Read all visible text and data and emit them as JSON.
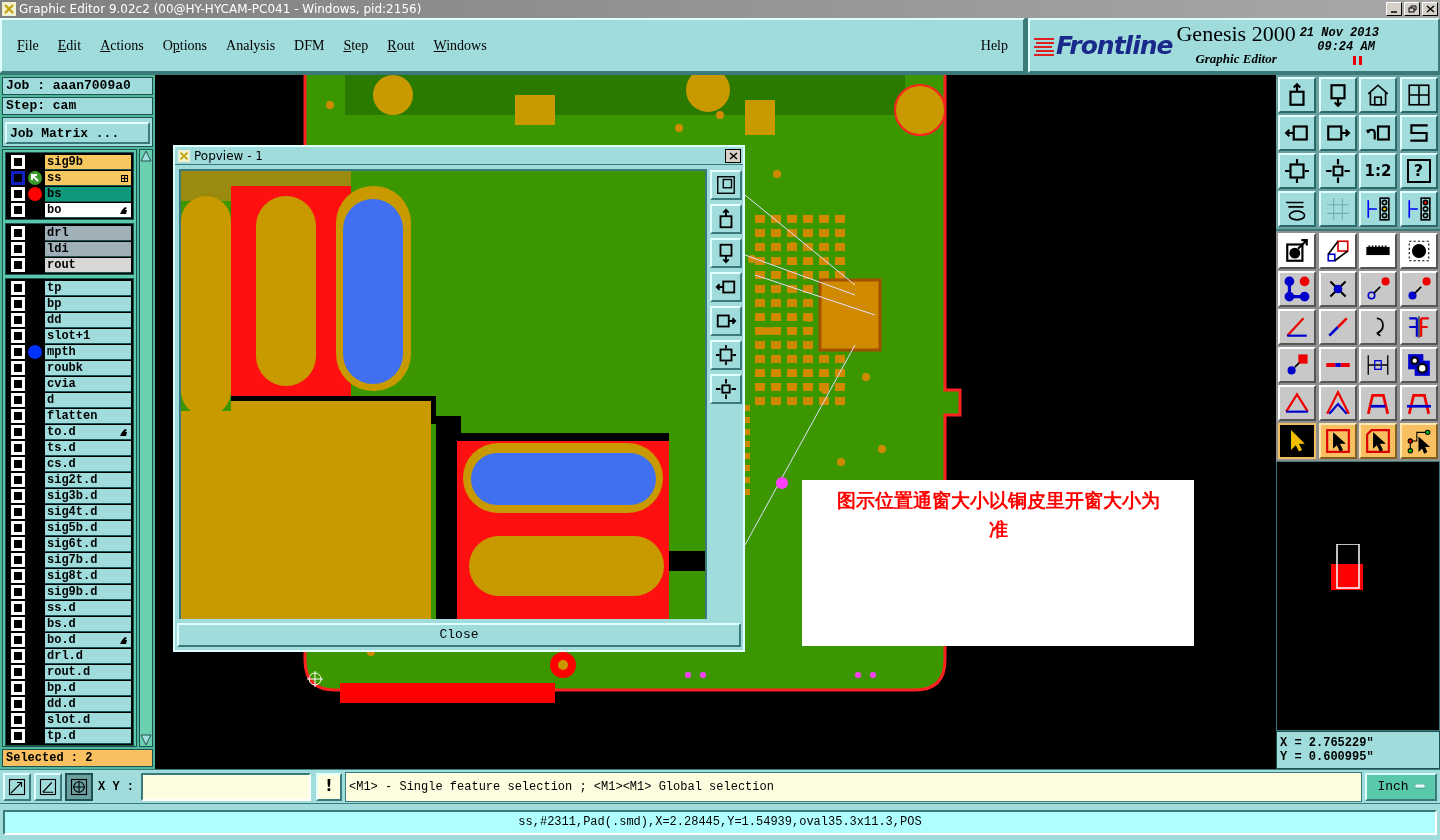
{
  "window": {
    "title": "Graphic Editor 9.02c2 (00@HY-HYCAM-PC041 - Windows, pid:2156)"
  },
  "menu": [
    {
      "key": "F",
      "rest": "ile"
    },
    {
      "key": "E",
      "rest": "dit"
    },
    {
      "key": "A",
      "rest": "ctions"
    },
    {
      "lead": "O",
      "key": "p",
      "rest": "tions"
    },
    {
      "lead": "Analysis"
    },
    {
      "lead": "DFM"
    },
    {
      "key": "S",
      "rest": "tep"
    },
    {
      "key": "R",
      "rest": "out"
    },
    {
      "key": "W",
      "rest": "indows"
    }
  ],
  "help": "Help",
  "brand": {
    "logo": "Frontline",
    "product": "Genesis 2000",
    "subtitle": "Graphic Editor",
    "date": "21 Nov 2013",
    "time": "09:24 AM"
  },
  "job": "Job : aaan7009a0",
  "step": "Step: cam",
  "job_matrix_button": "Job Matrix ...",
  "layer_groups": [
    [
      {
        "name": "sig9b",
        "color": "#f8c860",
        "affected": false
      },
      {
        "name": "ss",
        "color": "#f8c860",
        "affected": true,
        "marker": {
          "kind": "work"
        },
        "grid_icon": true
      },
      {
        "name": "bs",
        "color": "#10987a",
        "affected": false,
        "marker": {
          "kind": "dot",
          "color": "#ff0000"
        }
      },
      {
        "name": "bo",
        "color": "#ffffff",
        "affected": false,
        "hand_icon": true
      }
    ],
    [
      {
        "name": "drl",
        "color": "#a0b0b8",
        "affected": false
      },
      {
        "name": "ldi",
        "color": "#a0b0b8",
        "affected": false
      },
      {
        "name": "rout",
        "color": "#d8d8d8",
        "affected": false
      }
    ],
    [
      {
        "name": "tp",
        "color": "#a0dcdc",
        "affected": false
      },
      {
        "name": "bp",
        "color": "#a0dcdc",
        "affected": false
      },
      {
        "name": "dd",
        "color": "#a0dcdc",
        "affected": false
      },
      {
        "name": "slot+1",
        "color": "#a0dcdc",
        "affected": false
      },
      {
        "name": "mpth",
        "color": "#a0dcdc",
        "affected": false,
        "marker": {
          "kind": "dot",
          "color": "#0030ff"
        }
      },
      {
        "name": "roubk",
        "color": "#a0dcdc",
        "affected": false
      },
      {
        "name": "cvia",
        "color": "#a0dcdc",
        "affected": false
      },
      {
        "name": "d",
        "color": "#a0dcdc",
        "affected": false
      },
      {
        "name": "flatten",
        "color": "#a0dcdc",
        "affected": false
      },
      {
        "name": "to.d",
        "color": "#a0dcdc",
        "affected": false,
        "hand_icon": true
      },
      {
        "name": "ts.d",
        "color": "#a0dcdc",
        "affected": false
      },
      {
        "name": "cs.d",
        "color": "#a0dcdc",
        "affected": false
      },
      {
        "name": "sig2t.d",
        "color": "#a0dcdc",
        "affected": false
      },
      {
        "name": "sig3b.d",
        "color": "#a0dcdc",
        "affected": false
      },
      {
        "name": "sig4t.d",
        "color": "#a0dcdc",
        "affected": false
      },
      {
        "name": "sig5b.d",
        "color": "#a0dcdc",
        "affected": false
      },
      {
        "name": "sig6t.d",
        "color": "#a0dcdc",
        "affected": false
      },
      {
        "name": "sig7b.d",
        "color": "#a0dcdc",
        "affected": false
      },
      {
        "name": "sig8t.d",
        "color": "#a0dcdc",
        "affected": false
      },
      {
        "name": "sig9b.d",
        "color": "#a0dcdc",
        "affected": false
      },
      {
        "name": "ss.d",
        "color": "#a0dcdc",
        "affected": false
      },
      {
        "name": "bs.d",
        "color": "#a0dcdc",
        "affected": false
      },
      {
        "name": "bo.d",
        "color": "#a0dcdc",
        "affected": false,
        "hand_icon": true
      },
      {
        "name": "drl.d",
        "color": "#a0dcdc",
        "affected": false
      },
      {
        "name": "rout.d",
        "color": "#a0dcdc",
        "affected": false
      },
      {
        "name": "bp.d",
        "color": "#a0dcdc",
        "affected": false
      },
      {
        "name": "dd.d",
        "color": "#a0dcdc",
        "affected": false
      },
      {
        "name": "slot.d",
        "color": "#a0dcdc",
        "affected": false
      },
      {
        "name": "tp.d",
        "color": "#a0dcdc",
        "affected": false
      }
    ]
  ],
  "selected_count": "Selected : 2",
  "popview": {
    "title": "Popview - 1",
    "close_button": "Close"
  },
  "annotation": "图示位置通窗大小以铜皮里开窗大小为准",
  "toolbar": {
    "ratio_label": "1:2",
    "help_glyph": "?",
    "pick_modes": [
      {
        "selected": true
      },
      {
        "selected": false
      },
      {
        "selected": false
      },
      {
        "selected": false
      }
    ]
  },
  "coordinates": {
    "x": "X = 2.765229\"",
    "y": "Y = 0.600995\""
  },
  "command_bar": {
    "xy_label": "X Y :",
    "alert_glyph": "!",
    "message": "<M1> - Single feature selection ; <M1><M1> Global selection",
    "units": "Inch"
  },
  "status": "ss,#2311,Pad(.smd),X=2.28445,Y=1.54939,oval35.3x11.3,POS"
}
